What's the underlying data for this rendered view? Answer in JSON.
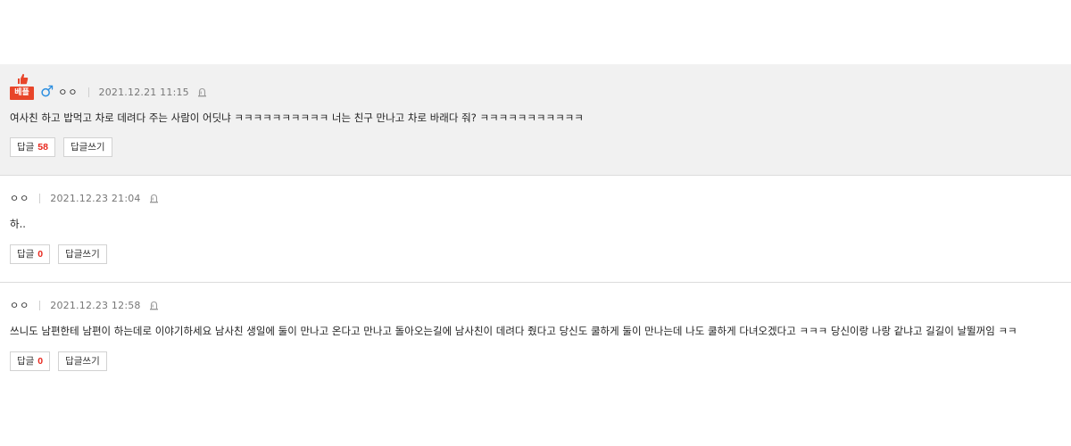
{
  "comments": [
    {
      "is_best": true,
      "best_label": "베플",
      "gender_icon": "♂",
      "nickname": "ㅇㅇ",
      "date": "2021.12.21 11:15",
      "text": "여사친 하고 밥먹고 차로 데려다 주는 사람이 어딧냐 ㅋㅋㅋㅋㅋㅋㅋㅋㅋㅋ 너는 친구 만나고 차로 바래다 줘? ㅋㅋㅋㅋㅋㅋㅋㅋㅋㅋㅋ",
      "reply_label": "답글",
      "reply_count": "58",
      "write_reply_label": "답글쓰기"
    },
    {
      "is_best": false,
      "nickname": "ㅇㅇ",
      "date": "2021.12.23 21:04",
      "text": "하..",
      "reply_label": "답글",
      "reply_count": "0",
      "write_reply_label": "답글쓰기"
    },
    {
      "is_best": false,
      "nickname": "ㅇㅇ",
      "date": "2021.12.23 12:58",
      "text": "쓰니도 남편한테 남편이 하는데로 이야기하세요 남사친 생일에 둘이 만나고 온다고 만나고 돌아오는길에 남사친이 데려다 줬다고 당신도 쿨하게 둘이 만나는데 나도 쿨하게 다녀오겠다고 ㅋㅋㅋ 당신이랑 나랑 같냐고 길길이 날뛸꺼임 ㅋㅋ",
      "reply_label": "답글",
      "reply_count": "0",
      "write_reply_label": "답글쓰기"
    }
  ],
  "colors": {
    "best_background": "#f1f1f1",
    "best_badge": "#e8452a",
    "reply_count": "#e8281e",
    "gender_male": "#2d8fe0"
  },
  "icons": {
    "best": "thumbs-up-icon",
    "gender": "male-icon",
    "report": "report-siren-icon"
  }
}
